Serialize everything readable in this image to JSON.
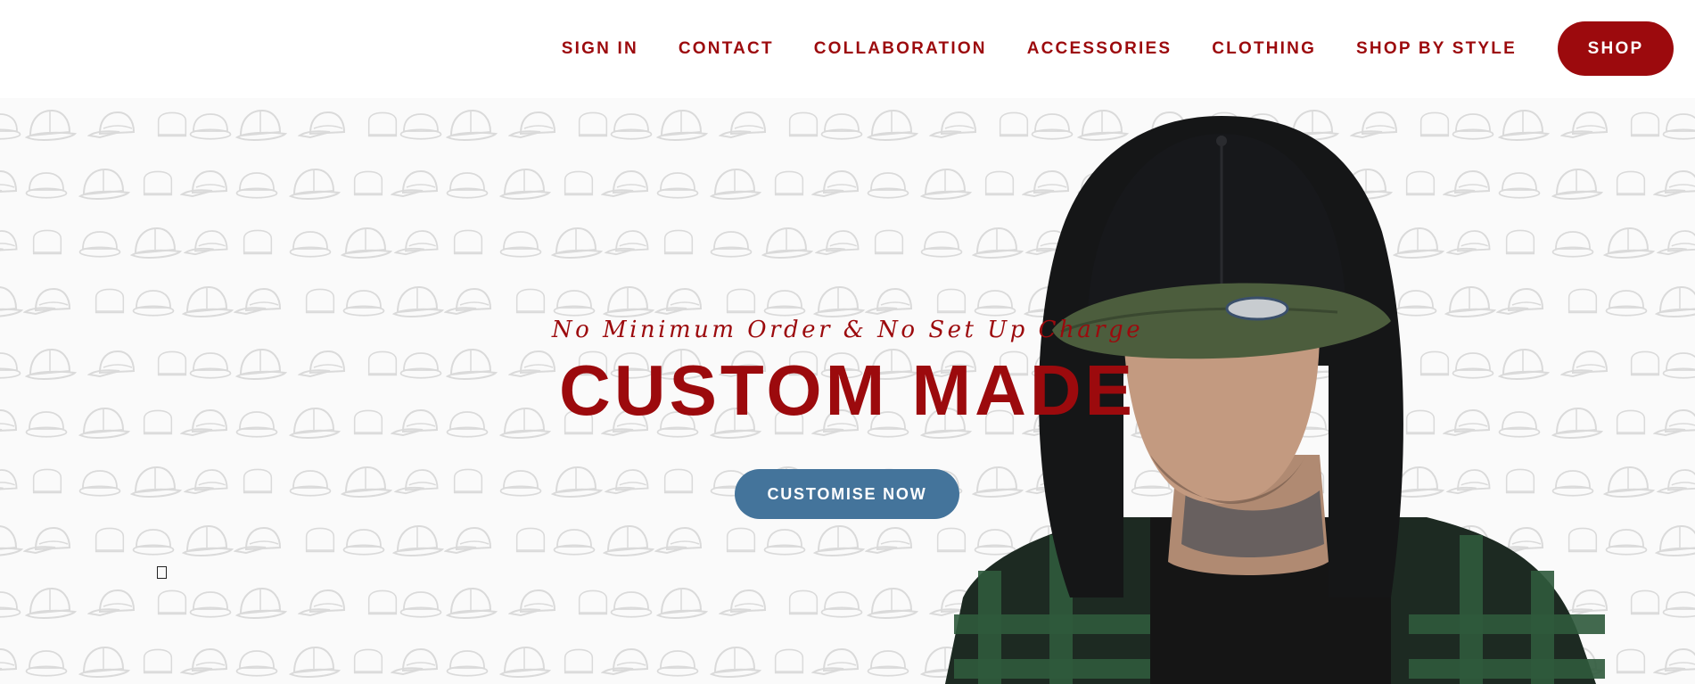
{
  "nav": {
    "items": [
      {
        "label": "SIGN IN"
      },
      {
        "label": "CONTACT"
      },
      {
        "label": "COLLABORATION"
      },
      {
        "label": "ACCESSORIES"
      },
      {
        "label": "CLOTHING"
      },
      {
        "label": "SHOP BY STYLE"
      }
    ],
    "shop_label": "SHOP"
  },
  "hero": {
    "tagline": "No Minimum Order & No Set Up Charge",
    "headline": "CUSTOM MADE",
    "cta_label": "CUSTOMISE NOW",
    "background_pattern": "cap-outline-pattern",
    "model_image": "model-in-black-snapback-cap-and-hoodie"
  },
  "colors": {
    "brand_red": "#9c0a0d",
    "cta_blue": "#44749b",
    "pattern_grey": "#d9d9d9"
  }
}
